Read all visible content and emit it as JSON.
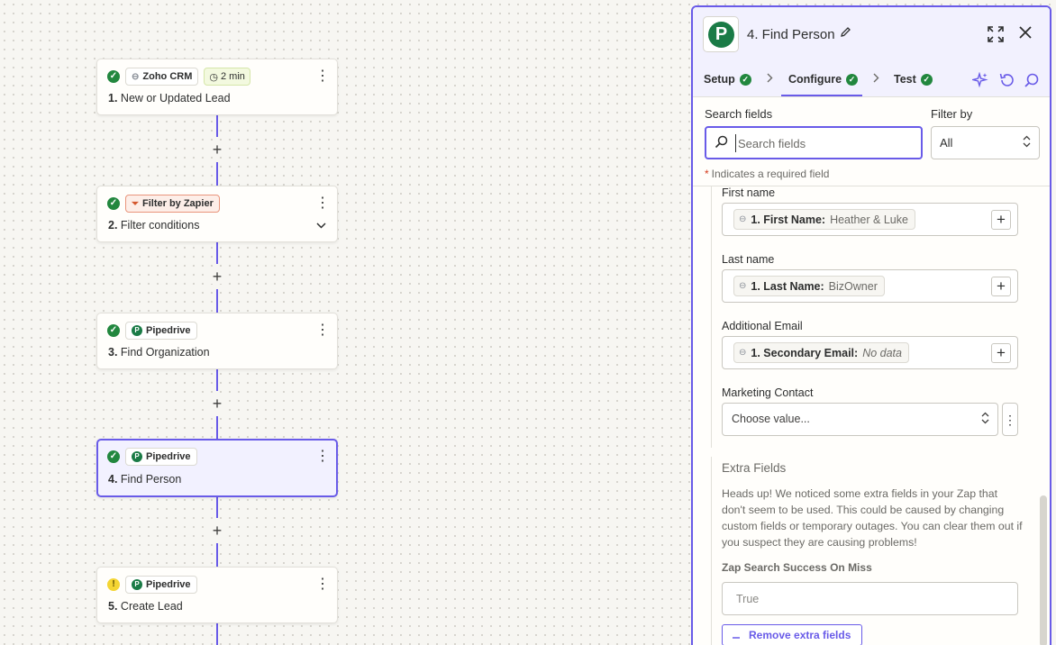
{
  "steps": [
    {
      "number": "1.",
      "title": "New or Updated Lead",
      "app": "Zoho CRM",
      "status": "ok",
      "time": "2 min"
    },
    {
      "number": "2.",
      "title": "Filter conditions",
      "app": "Filter by Zapier",
      "status": "ok"
    },
    {
      "number": "3.",
      "title": "Find Organization",
      "app": "Pipedrive",
      "status": "ok"
    },
    {
      "number": "4.",
      "title": "Find Person",
      "app": "Pipedrive",
      "status": "ok",
      "selected": true
    },
    {
      "number": "5.",
      "title": "Create Lead",
      "app": "Pipedrive",
      "status": "warning"
    }
  ],
  "icons": {
    "add": "+",
    "kebab": "⋮",
    "chevron_down": "⌄",
    "check": "✓",
    "warning": "!",
    "pipedrive_letter": "P",
    "link": "⊖",
    "clock": "◷",
    "filter": "⏷"
  },
  "panel": {
    "title": "4. Find Person",
    "tabs": [
      {
        "label": "Setup",
        "complete": true
      },
      {
        "label": "Configure",
        "complete": true,
        "active": true
      },
      {
        "label": "Test",
        "complete": true
      }
    ],
    "search_label": "Search fields",
    "search_placeholder": "Search fields",
    "filter_label": "Filter by",
    "filter_value": "All",
    "required_note": "Indicates a required field",
    "fields": [
      {
        "label": "First name",
        "pill_name": "1. First Name:",
        "pill_value": "Heather & Luke"
      },
      {
        "label": "Last name",
        "pill_name": "1. Last Name:",
        "pill_value": "BizOwner"
      },
      {
        "label": "Additional Email",
        "pill_name": "1. Secondary Email:",
        "pill_value": "No data"
      }
    ],
    "marketing": {
      "label": "Marketing Contact",
      "placeholder": "Choose value..."
    },
    "extra": {
      "title": "Extra Fields",
      "text": "Heads up! We noticed some extra fields in your Zap that don't seem to be used. This could be caused by changing custom fields or temporary outages. You can clear them out if you suspect they are causing problems!",
      "field_label": "Zap Search Success On Miss",
      "field_value": "True",
      "remove_button": "Remove extra fields"
    }
  },
  "colors": {
    "accent": "#695be8",
    "success": "#22873e",
    "warning": "#f4d533",
    "pipedrive": "#1a7b46"
  }
}
